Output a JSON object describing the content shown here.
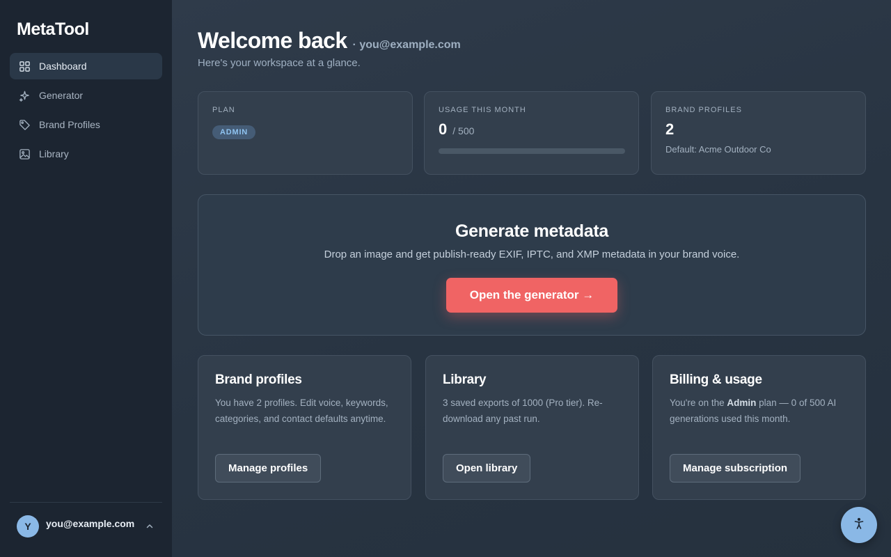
{
  "sidebar": {
    "brand": "MetaTool",
    "items": [
      {
        "label": "Dashboard",
        "icon": "dashboard-grid-icon",
        "active": true
      },
      {
        "label": "Generator",
        "icon": "sparkle-icon",
        "active": false
      },
      {
        "label": "Brand Profiles",
        "icon": "tag-icon",
        "active": false
      },
      {
        "label": "Library",
        "icon": "image-icon",
        "active": false
      }
    ],
    "user": {
      "initial": "Y",
      "email": "you@example.com"
    }
  },
  "header": {
    "title": "Welcome back",
    "email": "· you@example.com",
    "subtitle": "Here's your workspace at a glance."
  },
  "stats": {
    "plan": {
      "label": "PLAN",
      "badge": "ADMIN"
    },
    "usage": {
      "label": "USAGE THIS MONTH",
      "used": "0",
      "total": "/ 500",
      "fraction": 0
    },
    "profiles": {
      "label": "BRAND PROFILES",
      "count": "2",
      "default": "Default: Acme Outdoor Co"
    }
  },
  "hero": {
    "title": "Generate metadata",
    "subtitle": "Drop an image and get publish-ready EXIF, IPTC, and XMP metadata in your brand voice.",
    "button": "Open the generator →"
  },
  "cards": {
    "brand_profiles": {
      "title": "Brand profiles",
      "text": "You have 2 profiles. Edit voice, keywords, categories, and contact defaults anytime.",
      "button": "Manage profiles"
    },
    "library": {
      "title": "Library",
      "text": "3 saved exports of 1000 (Pro tier). Re-download any past run.",
      "button": "Open library"
    },
    "billing": {
      "title": "Billing & usage",
      "text_pre": "You're on the ",
      "text_plan": "Admin",
      "text_post": " plan — 0 of 500 AI generations used this month.",
      "button": "Manage subscription"
    }
  },
  "colors": {
    "accent": "#f06464",
    "badge_text": "#8fc3f0",
    "sidebar_bg": "#1c2531",
    "avatar_bg": "#8ab8e6"
  },
  "accessibility_button": {
    "icon": "accessibility-icon"
  }
}
